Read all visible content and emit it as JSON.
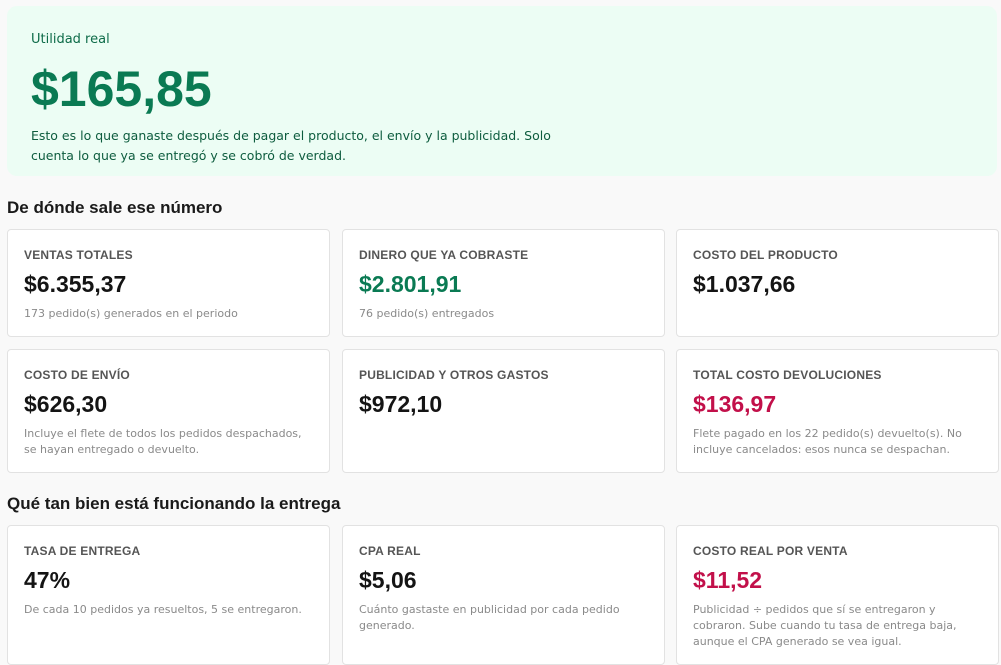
{
  "hero": {
    "label": "Utilidad real",
    "value": "$165,85",
    "description": "Esto es lo que ganaste después de pagar el producto, el envío y la publicidad. Solo cuenta lo que ya se entregó y se cobró de verdad."
  },
  "section1": {
    "title": "De dónde sale ese número",
    "cards": [
      {
        "label": "VENTAS TOTALES",
        "value": "$6.355,37",
        "note": "173 pedido(s) generados en el periodo"
      },
      {
        "label": "DINERO QUE YA COBRASTE",
        "value": "$2.801,91",
        "note": "76 pedido(s) entregados"
      },
      {
        "label": "COSTO DEL PRODUCTO",
        "value": "$1.037,66",
        "note": ""
      },
      {
        "label": "COSTO DE ENVÍO",
        "value": "$626,30",
        "note": "Incluye el flete de todos los pedidos despachados, se hayan entregado o devuelto."
      },
      {
        "label": "PUBLICIDAD Y OTROS GASTOS",
        "value": "$972,10",
        "note": ""
      },
      {
        "label": "TOTAL COSTO DEVOLUCIONES",
        "value": "$136,97",
        "note": "Flete pagado en los 22 pedido(s) devuelto(s). No incluye cancelados: esos nunca se despachan."
      }
    ]
  },
  "section2": {
    "title": "Qué tan bien está funcionando la entrega",
    "cards": [
      {
        "label": "TASA DE ENTREGA",
        "value": "47%",
        "note": "De cada 10 pedidos ya resueltos, 5 se entregaron."
      },
      {
        "label": "CPA REAL",
        "value": "$5,06",
        "note": "Cuánto gastaste en publicidad por cada pedido generado."
      },
      {
        "label": "COSTO REAL POR VENTA",
        "value": "$11,52",
        "note": "Publicidad ÷ pedidos que sí se entregaron y cobraron. Sube cuando tu tasa de entrega baja, aunque el CPA generado se vea igual."
      }
    ]
  },
  "colors": {
    "positive": "#0a7a53",
    "negative": "#c2104a",
    "hero_bg": "#ecfdf4"
  }
}
